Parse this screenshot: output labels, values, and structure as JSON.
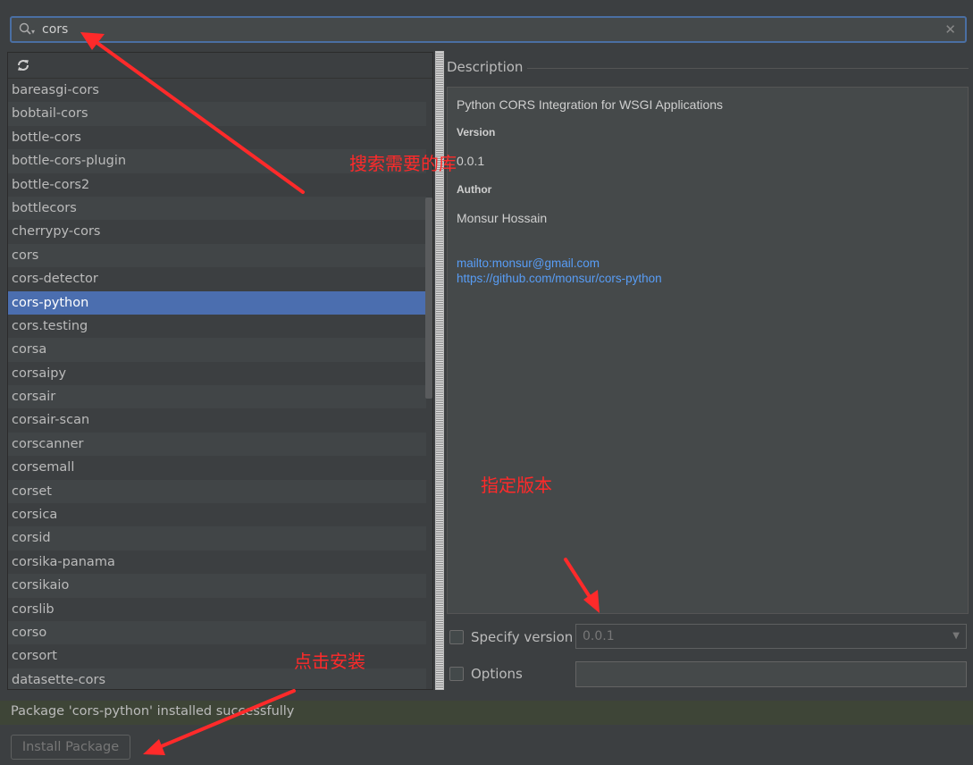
{
  "search": {
    "value": "cors"
  },
  "package_list": {
    "items": [
      "bareasgi-cors",
      "bobtail-cors",
      "bottle-cors",
      "bottle-cors-plugin",
      "bottle-cors2",
      "bottlecors",
      "cherrypy-cors",
      "cors",
      "cors-detector",
      "cors-python",
      "cors.testing",
      "corsa",
      "corsaipy",
      "corsair",
      "corsair-scan",
      "corscanner",
      "corsemall",
      "corset",
      "corsica",
      "corsid",
      "corsika-panama",
      "corsikaio",
      "corslib",
      "corso",
      "corsort",
      "datasette-cors"
    ],
    "selected": "cors-python"
  },
  "description": {
    "label": "Description",
    "summary": "Python CORS Integration for WSGI Applications",
    "version_heading": "Version",
    "version_value": "0.0.1",
    "author_heading": "Author",
    "author_value": "Monsur Hossain",
    "links": [
      "mailto:monsur@gmail.com",
      "https://github.com/monsur/cors-python"
    ]
  },
  "options": {
    "specify_version_label": "Specify version",
    "specify_version_checked": false,
    "version_select_value": "0.0.1",
    "options_label": "Options",
    "options_checked": false,
    "options_value": ""
  },
  "status": {
    "message": "Package 'cors-python' installed successfully"
  },
  "install_button": {
    "label": "Install Package"
  },
  "annotations": {
    "search_note": "搜索需要的库",
    "version_note": "指定版本",
    "install_note": "点击安装"
  },
  "colors": {
    "background": "#3c3f41",
    "selection": "#4b6eaf",
    "link": "#589df6",
    "annotation": "#ff2a2a",
    "status_bar": "#3e4537"
  }
}
